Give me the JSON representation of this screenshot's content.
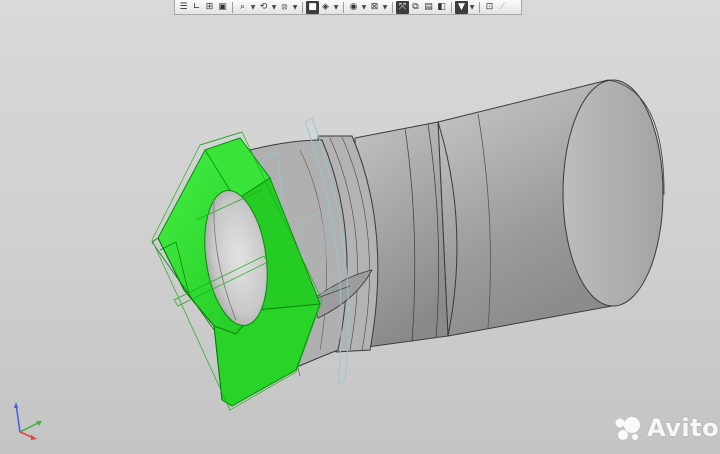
{
  "toolbar": {
    "buttons": [
      {
        "name": "view-list-icon",
        "glyph": "☰",
        "dropdown": false,
        "state": "normal"
      },
      {
        "name": "coordinate-system-icon",
        "glyph": "∟",
        "dropdown": false,
        "state": "normal"
      },
      {
        "name": "build-tree-icon",
        "glyph": "⊞",
        "dropdown": false,
        "state": "normal"
      },
      {
        "name": "show-all-icon",
        "glyph": "▣",
        "dropdown": false,
        "state": "normal"
      },
      {
        "name": "zoom-icon",
        "glyph": "⌕",
        "dropdown": true,
        "state": "normal"
      },
      {
        "name": "rotate-icon",
        "glyph": "⟲",
        "dropdown": true,
        "state": "normal"
      },
      {
        "name": "orientation-icon",
        "glyph": "⦻",
        "dropdown": true,
        "state": "normal"
      },
      {
        "name": "shaded-cube-icon",
        "glyph": "■",
        "dropdown": false,
        "state": "selected"
      },
      {
        "name": "display-mode-icon",
        "glyph": "◈",
        "dropdown": true,
        "state": "normal"
      },
      {
        "name": "hide-icon",
        "glyph": "◉",
        "dropdown": true,
        "state": "normal"
      },
      {
        "name": "section-icon",
        "glyph": "⊠",
        "dropdown": true,
        "state": "normal"
      },
      {
        "name": "filter-objects-icon",
        "glyph": "⤧",
        "dropdown": false,
        "state": "selected"
      },
      {
        "name": "copy-view-icon",
        "glyph": "⧉",
        "dropdown": false,
        "state": "normal"
      },
      {
        "name": "layers-icon",
        "glyph": "▤",
        "dropdown": false,
        "state": "normal"
      },
      {
        "name": "display-settings-icon",
        "glyph": "◧",
        "dropdown": false,
        "state": "normal"
      },
      {
        "name": "filter-icon",
        "glyph": "▼",
        "dropdown": true,
        "state": "selected"
      },
      {
        "name": "dimensions-icon",
        "glyph": "⊡",
        "dropdown": false,
        "state": "normal"
      },
      {
        "name": "measure-icon",
        "glyph": "⁄",
        "dropdown": false,
        "state": "disabled"
      }
    ],
    "separators_after": [
      3,
      6,
      8,
      10,
      14,
      15
    ]
  },
  "colors": {
    "background_top": "#d9d9d9",
    "background_bottom": "#c4c4c4",
    "selected_part": "#2ee82e",
    "part_gray": "#a9a9a9",
    "edge_line": "#3a3a3a",
    "plane_outline": "#8fc8d8",
    "axis_x": "#e04040",
    "axis_y": "#40b040",
    "axis_z": "#4060e0"
  },
  "watermark": {
    "text": "Avito"
  },
  "triad": {
    "labels": []
  }
}
